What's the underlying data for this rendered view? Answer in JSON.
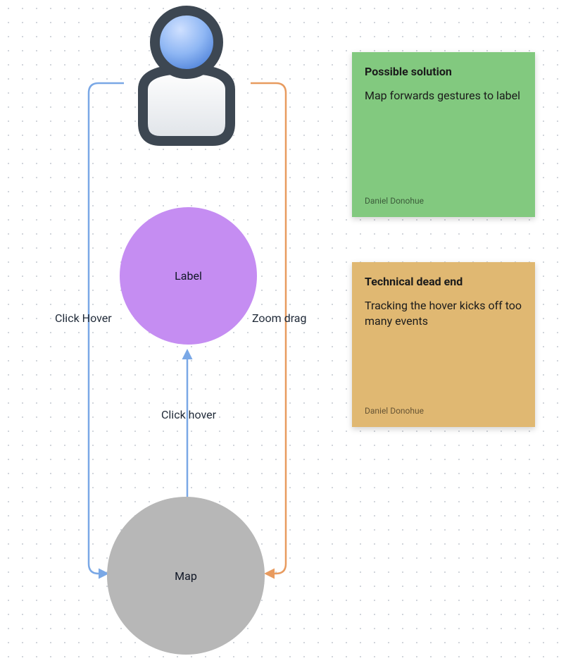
{
  "nodes": {
    "user": {
      "type": "icon",
      "icon": "user-icon"
    },
    "label": {
      "type": "circle",
      "text": "Label",
      "color": "#c58df2"
    },
    "map": {
      "type": "circle",
      "text": "Map",
      "color": "#b7b7b7"
    }
  },
  "edges": {
    "left": {
      "from": "user",
      "to": "map",
      "label": "Click Hover",
      "color": "#7aa8e6"
    },
    "right": {
      "from": "user",
      "to": "map",
      "label": "Zoom drag",
      "color": "#e89b5f"
    },
    "middle": {
      "from": "map",
      "to": "label",
      "label": "Click hover",
      "color": "#7aa8e6"
    }
  },
  "stickies": {
    "green": {
      "title": "Possible solution",
      "body": "Map forwards gestures to label",
      "author": "Daniel Donohue",
      "bg": "#82c97f"
    },
    "yellow": {
      "title": "Technical dead end",
      "body": "Tracking the hover kicks off too many events",
      "author": "Daniel Donohue",
      "bg": "#e0b872"
    }
  }
}
